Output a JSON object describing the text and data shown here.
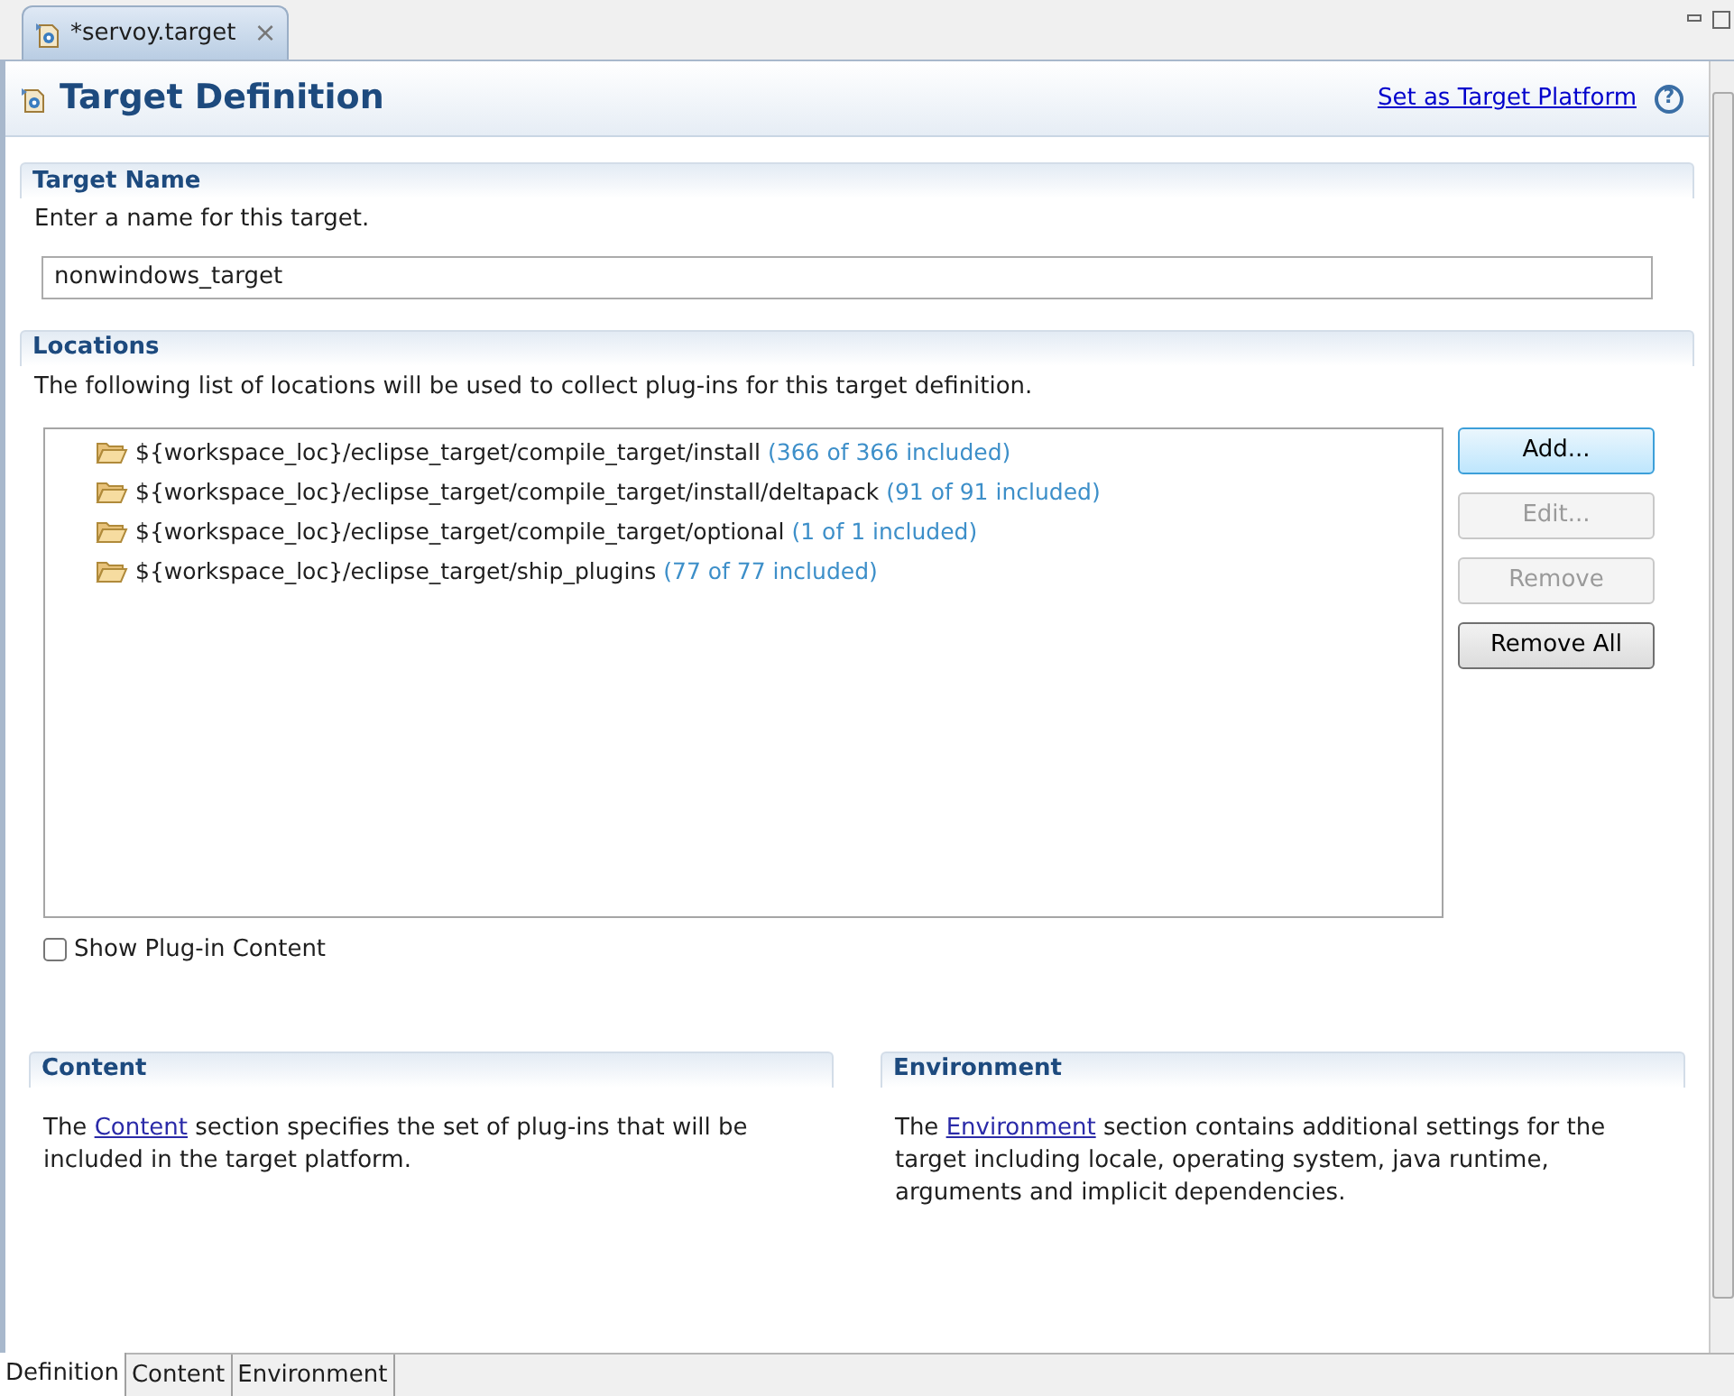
{
  "editor_tab": {
    "title": "*servoy.target",
    "close": "×"
  },
  "header": {
    "title": "Target Definition",
    "link": "Set as Target Platform",
    "help": "?"
  },
  "target_name": {
    "title": "Target Name",
    "description": "Enter a name for this target.",
    "value": "nonwindows_target"
  },
  "locations": {
    "title": "Locations",
    "description": "The following list of locations will be used to collect plug-ins for this target definition.",
    "items": [
      {
        "path": "${workspace_loc}/eclipse_target/compile_target/install",
        "count": "(366 of 366 included)"
      },
      {
        "path": "${workspace_loc}/eclipse_target/compile_target/install/deltapack",
        "count": "(91 of 91 included)"
      },
      {
        "path": "${workspace_loc}/eclipse_target/compile_target/optional",
        "count": "(1 of 1 included)"
      },
      {
        "path": "${workspace_loc}/eclipse_target/ship_plugins",
        "count": "(77 of 77 included)"
      }
    ],
    "buttons": [
      {
        "label": "Add...",
        "disabled": false,
        "focused": true
      },
      {
        "label": "Edit...",
        "disabled": true,
        "focused": false
      },
      {
        "label": "Remove",
        "disabled": true,
        "focused": false
      },
      {
        "label": "Remove All",
        "disabled": false,
        "focused": false
      }
    ],
    "show_content": {
      "label": "Show Plug-in Content",
      "checked": false
    }
  },
  "sections": [
    {
      "title": "Content",
      "before": "The ",
      "link": "Content",
      "after": " section specifies the set of plug-ins that will be included in the target platform."
    },
    {
      "title": "Environment",
      "before": "The ",
      "link": "Environment",
      "after": " section contains additional settings for the target including locale, operating system, java runtime, arguments and implicit dependencies."
    }
  ],
  "bottom_tabs": [
    {
      "label": "Definition",
      "selected": true
    },
    {
      "label": "Content",
      "selected": false
    },
    {
      "label": "Environment",
      "selected": false
    }
  ]
}
